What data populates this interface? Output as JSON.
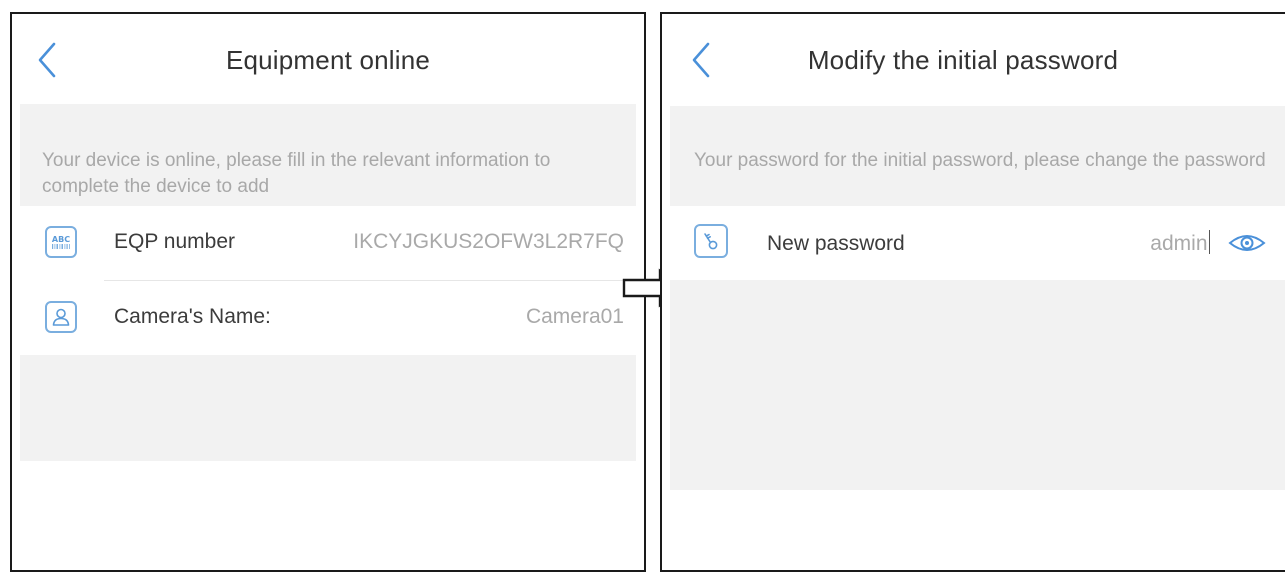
{
  "left_screen": {
    "title": "Equipment online",
    "instruction": "Your device is online, please fill in the relevant information to complete the device to add",
    "fields": [
      {
        "label": "EQP number",
        "value": "IKCYJGKUS2OFW3L2R7FQ",
        "icon": "abc-barcode-icon"
      },
      {
        "label": "Camera's Name:",
        "value": "Camera01",
        "icon": "user-icon"
      }
    ]
  },
  "right_screen": {
    "title": "Modify the initial password",
    "instruction": "Your password for the initial password, please change the password",
    "password_field": {
      "label": "New password",
      "value": "admin",
      "icon": "key-icon"
    }
  },
  "colors": {
    "accent": "#4a90d9",
    "band": "#f2f2f2",
    "muted_text": "#a8a8a8",
    "text": "#333333"
  }
}
